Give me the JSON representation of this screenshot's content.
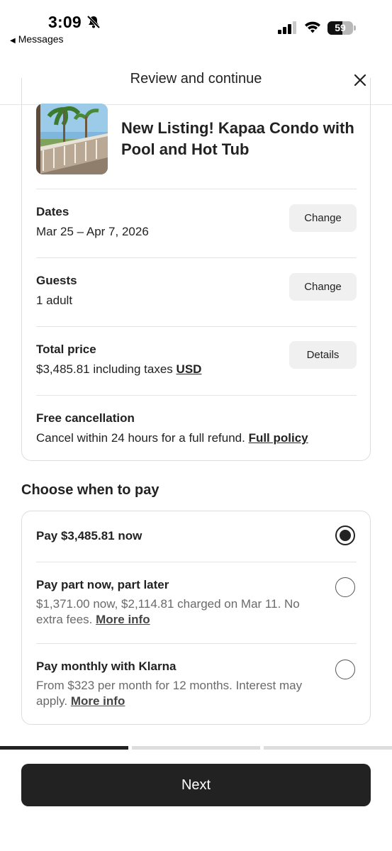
{
  "status_bar": {
    "time": "3:09",
    "back_label": "Messages",
    "battery": "59",
    "battery_level": 0.59
  },
  "header": {
    "title": "Review and continue"
  },
  "listing": {
    "title": "New Listing! Kapaa Condo with Pool and Hot Tub"
  },
  "dates": {
    "label": "Dates",
    "value": "Mar 25 – Apr 7, 2026",
    "button": "Change"
  },
  "guests": {
    "label": "Guests",
    "value": "1 adult",
    "button": "Change"
  },
  "total": {
    "label": "Total price",
    "value": "$3,485.81 including taxes",
    "currency": "USD",
    "button": "Details"
  },
  "cancellation": {
    "label": "Free cancellation",
    "text": "Cancel within 24 hours for a full refund.",
    "link": "Full policy"
  },
  "payment": {
    "title": "Choose when to pay",
    "options": [
      {
        "label": "Pay $3,485.81 now",
        "selected": true
      },
      {
        "label": "Pay part now, part later",
        "desc": "$1,371.00 now,  $2,114.81 charged on Mar 11. No extra fees.",
        "link": "More info",
        "selected": false
      },
      {
        "label": "Pay monthly with Klarna",
        "desc": "From $323 per month for 12 months. Interest may apply.",
        "link": "More info",
        "selected": false
      }
    ]
  },
  "progress": {
    "steps": 3,
    "current": 1
  },
  "next_button": "Next",
  "colors": {
    "primary": "#222222",
    "muted": "#6a6a6a",
    "button_bg": "#f0f0f0",
    "border": "#dddddd"
  }
}
